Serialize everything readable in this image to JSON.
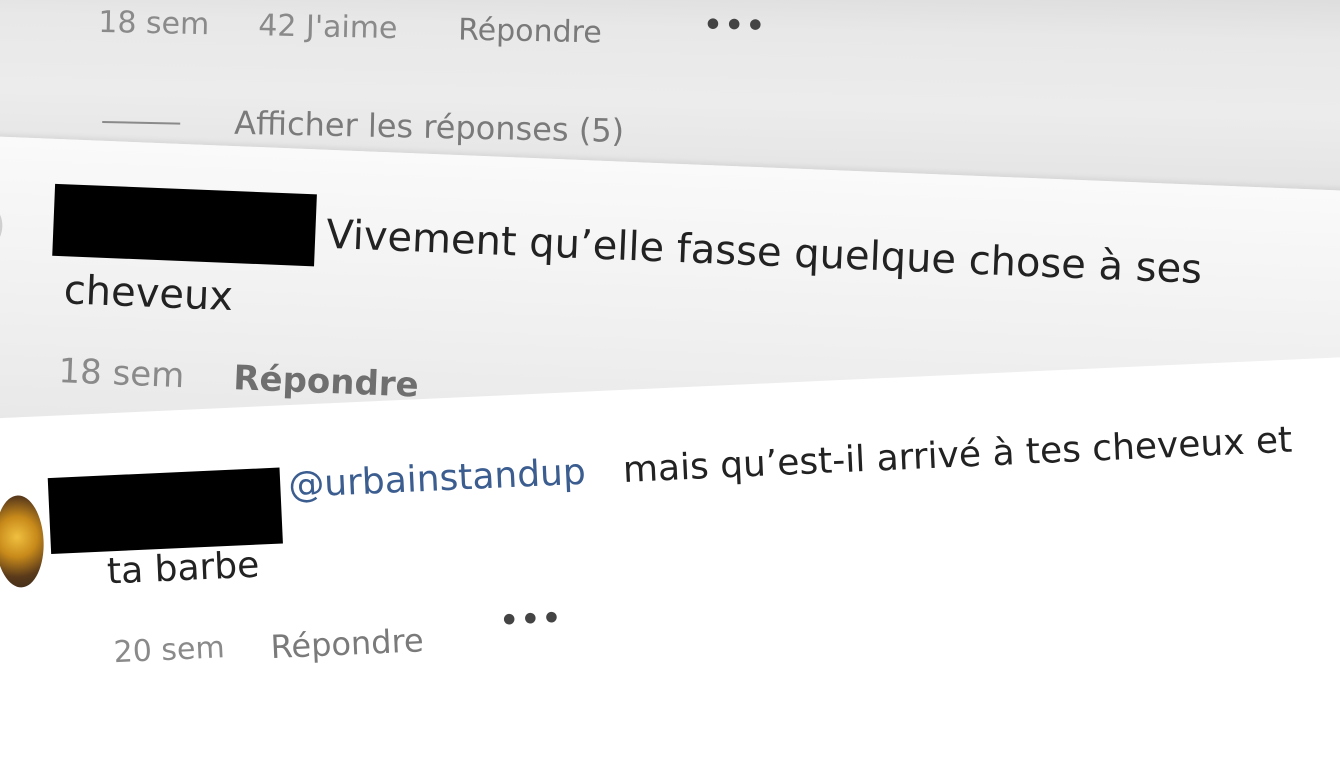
{
  "comments": [
    {
      "time": "18 sem",
      "likes": "42 J'aime",
      "reply": "Répondre",
      "more": "•••",
      "view_replies": "Afficher les réponses (5)"
    },
    {
      "text_line1": "Vivement qu’elle fasse quelque chose à ses",
      "text_line2": "cheveux",
      "time": "18 sem",
      "reply": "Répondre"
    },
    {
      "mention": "@urbainstandup",
      "text_line1": "mais qu’est-il arrivé à tes cheveux et",
      "text_line2": "ta barbe",
      "time": "20 sem",
      "reply": "Répondre",
      "more": "•••"
    }
  ],
  "colors": {
    "mention": "#3b5d8f",
    "meta": "#8a8a8a",
    "text": "#222222"
  }
}
